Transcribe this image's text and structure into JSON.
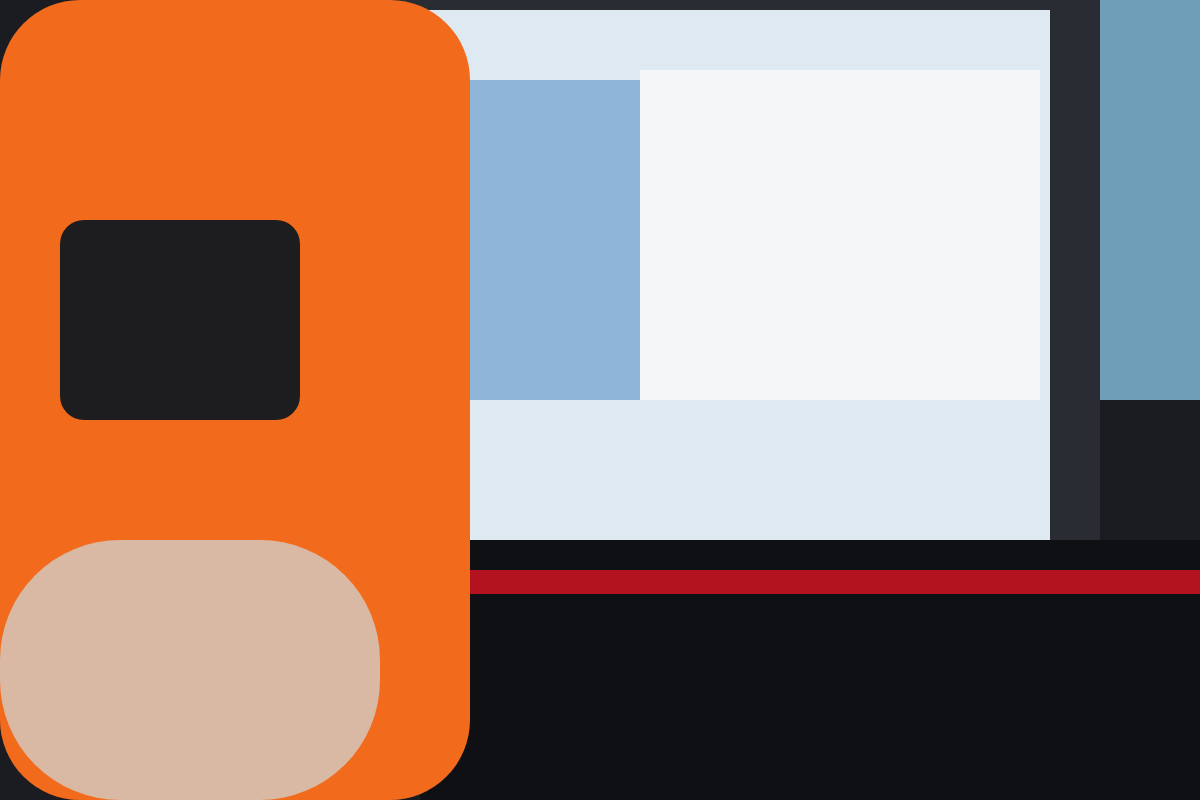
{
  "scene": {
    "kind": "photograph"
  }
}
